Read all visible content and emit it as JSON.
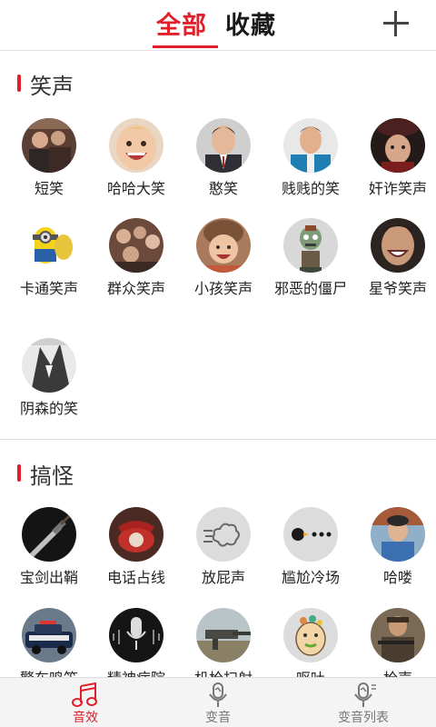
{
  "header": {
    "tabs": [
      {
        "label": "全部",
        "active": true
      },
      {
        "label": "收藏",
        "active": false
      }
    ],
    "add_icon": "plus-icon"
  },
  "sections": [
    {
      "title": "笑声",
      "items": [
        {
          "label": "短笑"
        },
        {
          "label": "哈哈大笑"
        },
        {
          "label": "憨笑"
        },
        {
          "label": "贱贱的笑"
        },
        {
          "label": "奸诈笑声"
        },
        {
          "label": "卡通笑声"
        },
        {
          "label": "群众笑声"
        },
        {
          "label": "小孩笑声"
        },
        {
          "label": "邪恶的僵尸"
        },
        {
          "label": "星爷笑声"
        },
        {
          "label": "阴森的笑"
        }
      ]
    },
    {
      "title": "搞怪",
      "items": [
        {
          "label": "宝剑出鞘"
        },
        {
          "label": "电话占线"
        },
        {
          "label": "放屁声"
        },
        {
          "label": "尴尬冷场"
        },
        {
          "label": "哈喽"
        },
        {
          "label": "警车鸣笛"
        },
        {
          "label": "精神病院"
        },
        {
          "label": "机枪扫射"
        },
        {
          "label": "呕吐"
        },
        {
          "label": "枪声"
        }
      ]
    }
  ],
  "bottom_nav": [
    {
      "label": "音效",
      "icon": "music-note-icon",
      "active": true
    },
    {
      "label": "变音",
      "icon": "microphone-icon",
      "active": false
    },
    {
      "label": "变音列表",
      "icon": "mic-list-icon",
      "active": false
    }
  ],
  "colors": {
    "accent": "#e0202a",
    "inactive": "#777777"
  }
}
